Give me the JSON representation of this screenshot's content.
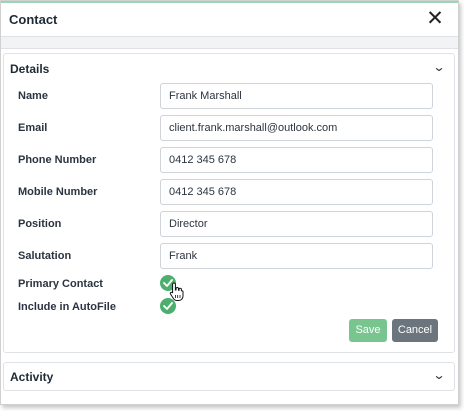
{
  "dialog": {
    "title": "Contact",
    "close_icon": "close-icon",
    "accent_color": "#9bd4b7"
  },
  "details": {
    "section_title": "Details",
    "fields": [
      {
        "label": "Name",
        "value": "Frank Marshall"
      },
      {
        "label": "Email",
        "value": "client.frank.marshall@outlook.com"
      },
      {
        "label": "Phone Number",
        "value": "0412 345 678"
      },
      {
        "label": "Mobile Number",
        "value": "0412 345 678"
      },
      {
        "label": "Position",
        "value": "Director"
      },
      {
        "label": "Salutation",
        "value": "Frank"
      }
    ],
    "toggles": [
      {
        "label": "Primary Contact",
        "checked": true
      },
      {
        "label": "Include in AutoFile",
        "checked": true
      }
    ],
    "check_color": "#4caf6e",
    "save_label": "Save",
    "cancel_label": "Cancel"
  },
  "activity": {
    "section_title": "Activity"
  }
}
